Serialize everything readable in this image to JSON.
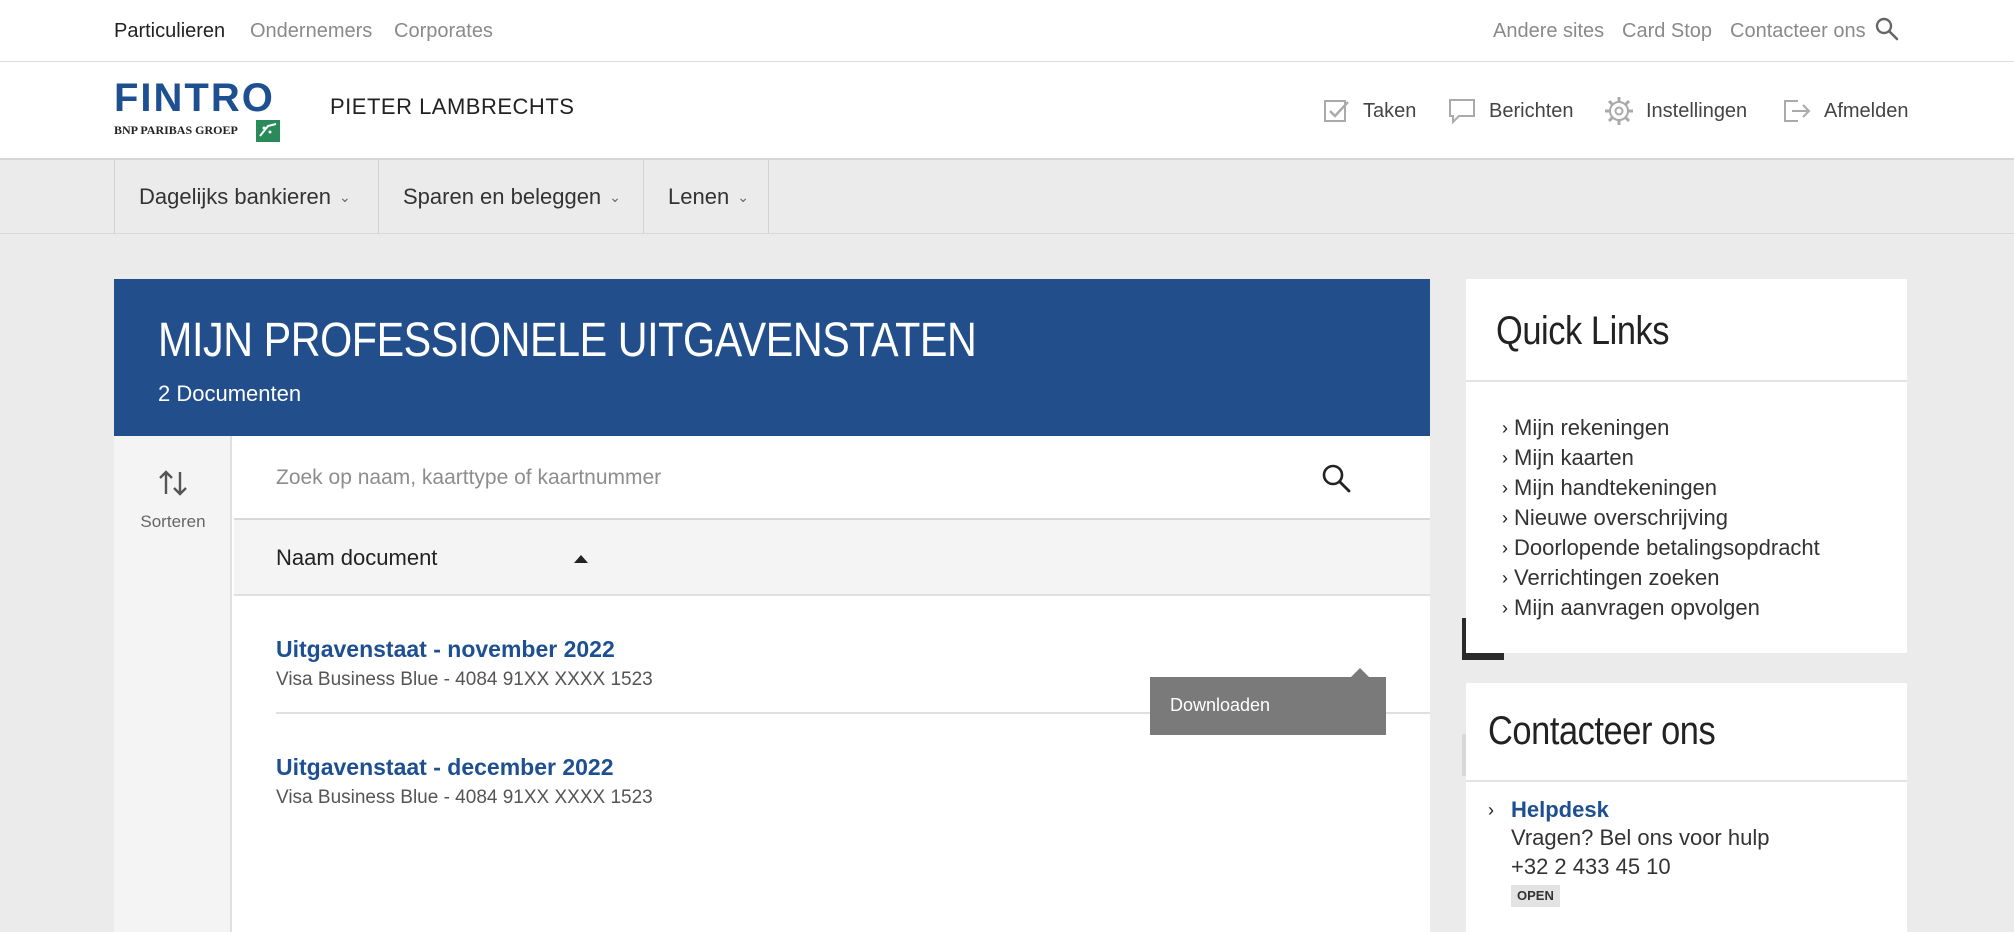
{
  "topbar": {
    "segments": [
      "Particulieren",
      "Ondernemers",
      "Corporates"
    ],
    "links": [
      "Andere sites",
      "Card Stop",
      "Contacteer ons"
    ],
    "search_icon": "search-icon"
  },
  "header": {
    "logo": {
      "brand": "FINTRO",
      "sub": "BNP PARIBAS GROEP"
    },
    "username": "PIETER LAMBRECHTS",
    "actions": [
      {
        "label": "Taken",
        "icon": "checkbox-icon"
      },
      {
        "label": "Berichten",
        "icon": "message-icon"
      },
      {
        "label": "Instellingen",
        "icon": "gear-icon"
      },
      {
        "label": "Afmelden",
        "icon": "logout-icon"
      }
    ]
  },
  "nav": {
    "items": [
      "Dagelijks bankieren",
      "Sparen en beleggen",
      "Lenen"
    ]
  },
  "main": {
    "title": "MIJN PROFESSIONELE UITGAVENSTATEN",
    "subtitle": "2 Documenten",
    "sort_label": "Sorteren",
    "search_placeholder": "Zoek op naam, kaarttype of kaartnummer",
    "column_header": "Naam document",
    "documents": [
      {
        "title": "Uitgavenstaat - november 2022",
        "meta": "Visa Business Blue - 4084 91XX XXXX 1523"
      },
      {
        "title": "Uitgavenstaat - december 2022",
        "meta": "Visa Business Blue - 4084 91XX XXXX 1523"
      }
    ],
    "popover_label": "Downloaden"
  },
  "quick_links": {
    "title": "Quick Links",
    "items": [
      "Mijn rekeningen",
      "Mijn kaarten",
      "Mijn handtekeningen",
      "Nieuwe overschrijving",
      "Doorlopende betalingsopdracht",
      "Verrichtingen zoeken",
      "Mijn aanvragen opvolgen"
    ]
  },
  "contact": {
    "title": "Contacteer ons",
    "helpdesk": "Helpdesk",
    "line1": "Vragen? Bel ons voor hulp",
    "phone": "+32 2 433 45 10",
    "status": "OPEN"
  },
  "colors": {
    "brand_blue": "#234e8c",
    "link_blue": "#1d4f91",
    "page_bg": "#ebebeb",
    "popover": "#7a7a7a"
  }
}
